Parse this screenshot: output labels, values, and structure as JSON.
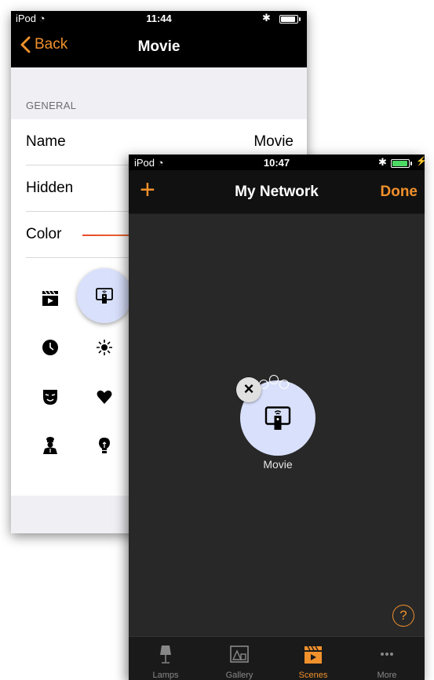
{
  "back_screen": {
    "status": {
      "carrier": "iPod",
      "time": "11:44"
    },
    "nav": {
      "back_label": "Back",
      "title": "Movie"
    },
    "section_header": "GENERAL",
    "rows": {
      "name": {
        "label": "Name",
        "value": "Movie"
      },
      "hidden": {
        "label": "Hidden"
      },
      "color": {
        "label": "Color"
      }
    },
    "icon_grid": [
      "clapperboard-icon",
      "remote-icon",
      "clock-icon",
      "sun-icon",
      "mask-icon",
      "heart-icon",
      "chef-icon",
      "bulb-icon"
    ],
    "selected_icon": "remote-icon"
  },
  "front_screen": {
    "status": {
      "carrier": "iPod",
      "time": "10:47"
    },
    "nav": {
      "add_glyph": "+",
      "title": "My Network",
      "done_label": "Done"
    },
    "scene": {
      "label": "Movie",
      "icon": "remote-icon",
      "delete_glyph": "×"
    },
    "help_glyph": "?",
    "tabs": [
      {
        "label": "Lamps",
        "icon": "lamp-icon"
      },
      {
        "label": "Gallery",
        "icon": "gallery-icon"
      },
      {
        "label": "Scenes",
        "icon": "clapperboard-icon"
      },
      {
        "label": "More",
        "icon": "more-icon"
      }
    ],
    "active_tab": "Scenes"
  },
  "colors": {
    "accent": "#f0912c",
    "selection": "#d9e0fb",
    "battery_charging": "#4cd964"
  }
}
